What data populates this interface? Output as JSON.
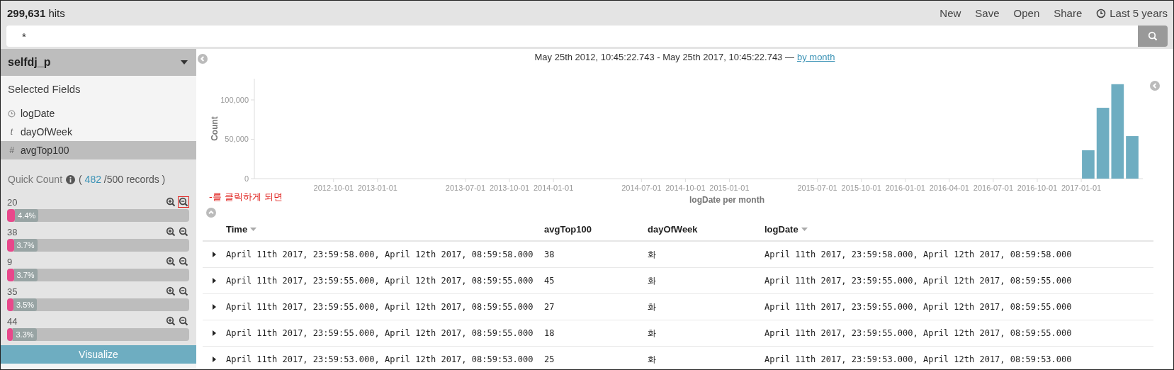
{
  "hits": "**299,631** hits",
  "menu": [
    {
      "label": "New",
      "kind": "action"
    },
    {
      "label": "Save",
      "kind": "action"
    },
    {
      "label": "Open",
      "kind": "action"
    },
    {
      "label": "Share",
      "kind": "action"
    },
    {
      "label": "Last 5 years",
      "kind": "time"
    }
  ],
  "search": {
    "value": "*"
  },
  "sidebar": {
    "index_pattern": "selfdj_p",
    "selected_fields_title": "Selected Fields",
    "fields": [
      {
        "name": "logDate",
        "kind": "date",
        "selected": false
      },
      {
        "name": "dayOfWeek",
        "kind": "string",
        "glyph": "t",
        "selected": false
      },
      {
        "name": "avgTop100",
        "kind": "number",
        "glyph": "#",
        "selected": true
      }
    ],
    "quick_count": {
      "title": "Quick Count",
      "prefix": "( ",
      "shown": "482",
      "suffix": " /500 records )",
      "items": [
        {
          "value": "20",
          "percent": "4.4%",
          "level": 0.044,
          "outlined": true
        },
        {
          "value": "38",
          "percent": "3.7%",
          "level": 0.037,
          "outlined": false
        },
        {
          "value": "9",
          "percent": "3.7%",
          "level": 0.037,
          "outlined": false
        },
        {
          "value": "35",
          "percent": "3.5%",
          "level": 0.035,
          "outlined": false
        },
        {
          "value": "44",
          "percent": "3.3%",
          "level": 0.033,
          "outlined": false
        }
      ]
    },
    "visualize_button": "Visualize"
  },
  "annotation": "-를 클릭하게 되면",
  "histogram": {
    "range": "May 25th 2012, 10:45:22.743 - May 25th 2017, 10:45:22.743 —",
    "interval": "by month",
    "chart_data": {
      "type": "bar",
      "xlabel": "logDate per month",
      "ylabel": "Count",
      "ylim": [
        0,
        127000
      ],
      "categories": [
        null,
        null,
        null,
        null,
        null,
        "2012-10-01",
        null,
        null,
        "2013-01-01",
        null,
        null,
        null,
        null,
        null,
        "2013-07-01",
        null,
        null,
        "2013-10-01",
        null,
        null,
        "2014-01-01",
        null,
        null,
        null,
        null,
        null,
        "2014-07-01",
        null,
        null,
        "2014-10-01",
        null,
        null,
        "2015-01-01",
        null,
        null,
        null,
        null,
        null,
        "2015-07-01",
        null,
        null,
        "2015-10-01",
        null,
        null,
        "2016-01-01",
        null,
        null,
        "2016-04-01",
        null,
        null,
        "2016-07-01",
        null,
        null,
        "2016-10-01",
        null,
        null,
        "2017-01-01",
        null,
        null,
        null,
        null
      ],
      "values": [
        null,
        null,
        null,
        null,
        null,
        null,
        null,
        null,
        null,
        null,
        null,
        null,
        null,
        null,
        null,
        null,
        null,
        null,
        null,
        null,
        null,
        null,
        null,
        null,
        null,
        null,
        null,
        null,
        null,
        null,
        null,
        null,
        null,
        null,
        null,
        null,
        null,
        null,
        null,
        null,
        null,
        null,
        null,
        null,
        null,
        null,
        null,
        null,
        null,
        null,
        null,
        null,
        null,
        null,
        null,
        null,
        36000,
        90000,
        120000,
        54000,
        null
      ],
      "yticks": [
        {
          "value": 0,
          "label": "0"
        },
        {
          "value": 50000,
          "label": "50,000"
        },
        {
          "value": 100000,
          "label": "100,000"
        }
      ]
    }
  },
  "table": {
    "columns": [
      {
        "label": "Time",
        "sortable": true
      },
      {
        "label": "avgTop100",
        "sortable": false
      },
      {
        "label": "dayOfWeek",
        "sortable": false
      },
      {
        "label": "logDate",
        "sortable": true
      }
    ],
    "rows": [
      {
        "cells": [
          "April 11th 2017, 23:59:58.000, April 12th 2017, 08:59:58.000",
          "38",
          "화",
          "April 11th 2017, 23:59:58.000, April 12th 2017, 08:59:58.000"
        ]
      },
      {
        "cells": [
          "April 11th 2017, 23:59:55.000, April 12th 2017, 08:59:55.000",
          "45",
          "화",
          "April 11th 2017, 23:59:55.000, April 12th 2017, 08:59:55.000"
        ]
      },
      {
        "cells": [
          "April 11th 2017, 23:59:55.000, April 12th 2017, 08:59:55.000",
          "27",
          "화",
          "April 11th 2017, 23:59:55.000, April 12th 2017, 08:59:55.000"
        ]
      },
      {
        "cells": [
          "April 11th 2017, 23:59:55.000, April 12th 2017, 08:59:55.000",
          "18",
          "화",
          "April 11th 2017, 23:59:55.000, April 12th 2017, 08:59:55.000"
        ]
      },
      {
        "cells": [
          "April 11th 2017, 23:59:53.000, April 12th 2017, 08:59:53.000",
          "25",
          "화",
          "April 11th 2017, 23:59:53.000, April 12th 2017, 08:59:53.000"
        ]
      }
    ]
  }
}
